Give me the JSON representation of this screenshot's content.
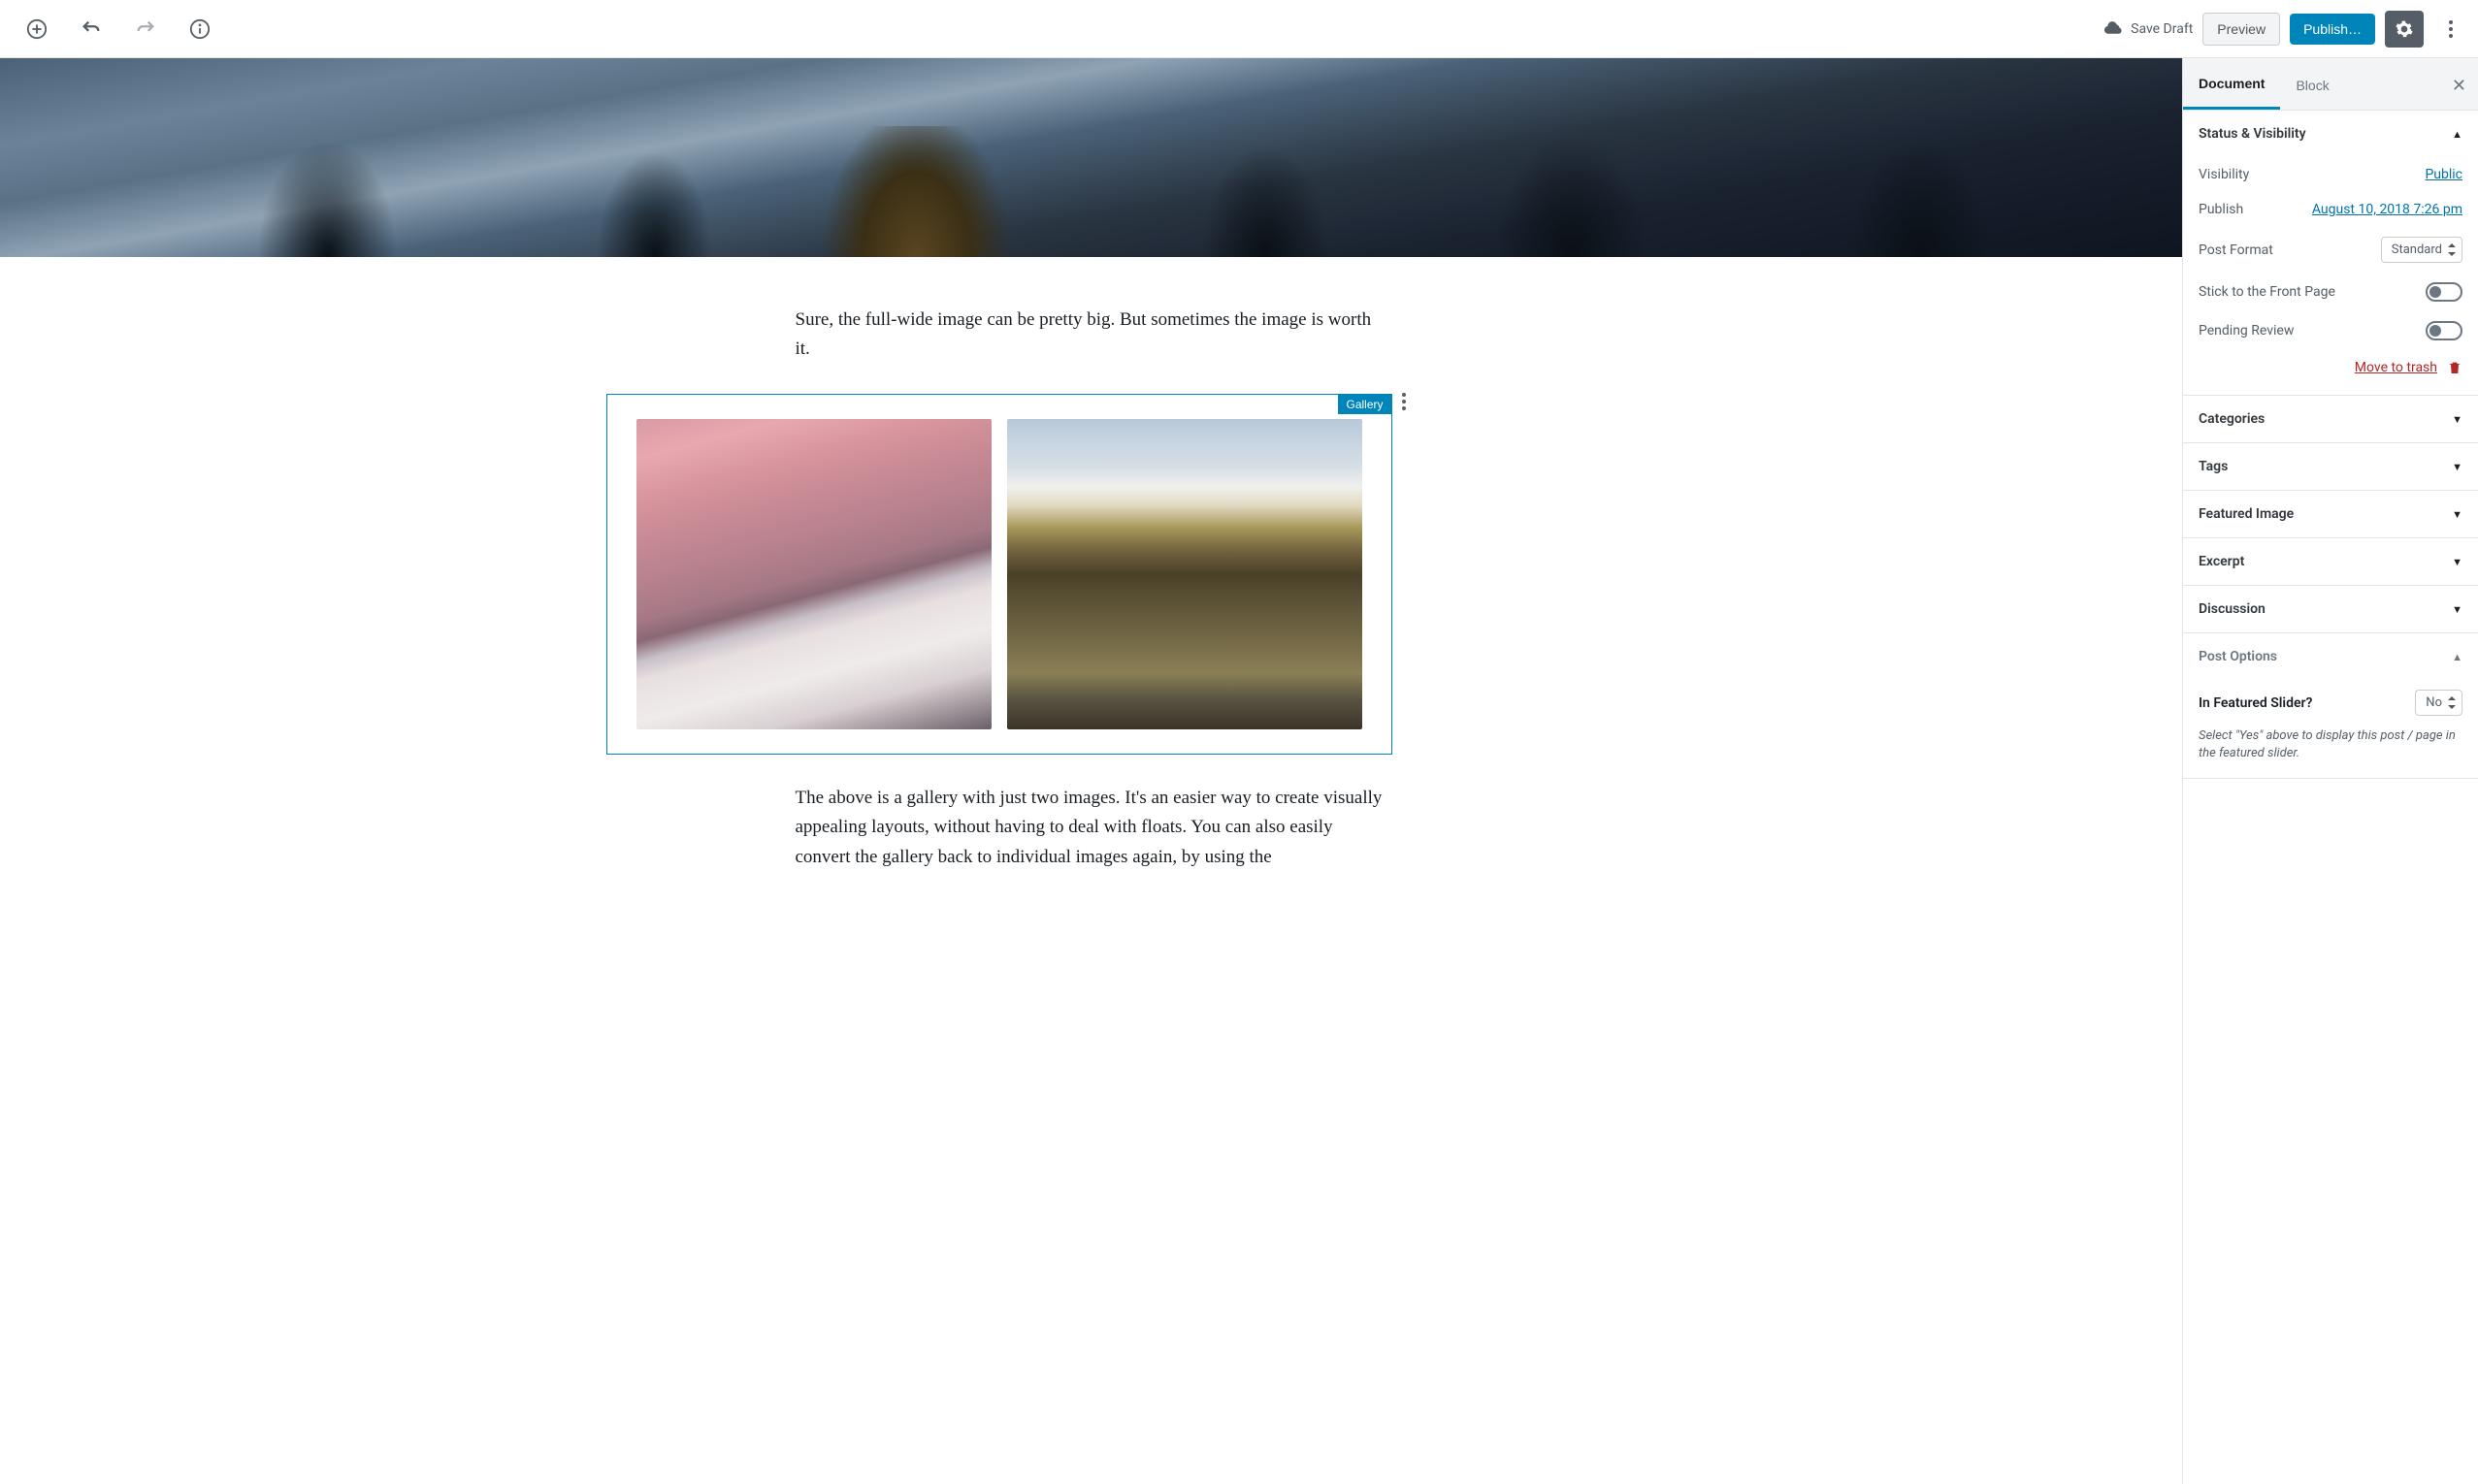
{
  "top": {
    "save_draft": "Save Draft",
    "preview": "Preview",
    "publish": "Publish…"
  },
  "sidebar": {
    "tabs": {
      "document": "Document",
      "block": "Block"
    },
    "status": {
      "title": "Status & Visibility",
      "visibility_label": "Visibility",
      "visibility_value": "Public",
      "publish_label": "Publish",
      "publish_value": "August 10, 2018 7:26 pm",
      "post_format_label": "Post Format",
      "post_format_value": "Standard",
      "stick_label": "Stick to the Front Page",
      "pending_label": "Pending Review",
      "trash": "Move to trash"
    },
    "panels": {
      "categories": "Categories",
      "tags": "Tags",
      "featured_image": "Featured Image",
      "excerpt": "Excerpt",
      "discussion": "Discussion",
      "post_options": "Post Options"
    },
    "post_options": {
      "featured_slider_label": "In Featured Slider?",
      "featured_slider_value": "No",
      "helper": "Select \"Yes\" above to display this post / page in the featured slider."
    }
  },
  "content": {
    "para1": "Sure, the full-wide image can be pretty big. But sometimes the image is worth it.",
    "gallery_label": "Gallery",
    "para2": "The above is a gallery with just two images. It's an easier way to create visually appealing layouts, without having to deal with floats. You can also easily convert the gallery back to individual images again, by using the"
  }
}
